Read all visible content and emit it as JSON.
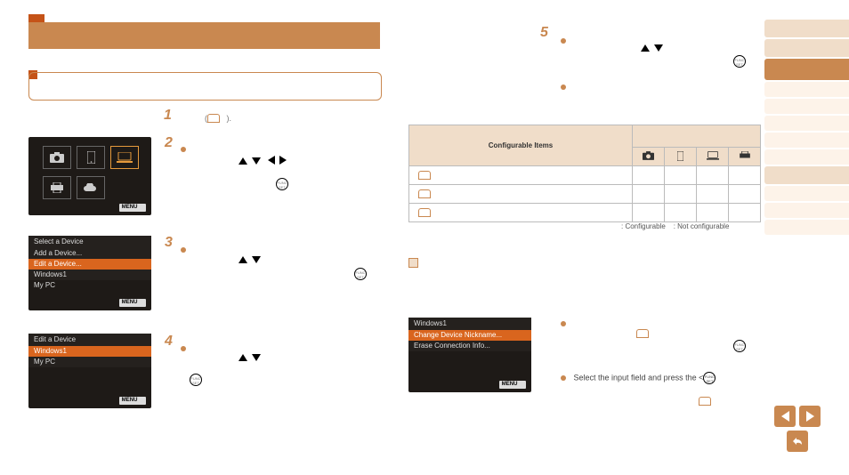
{
  "tabs": {
    "count": 12,
    "active_index": 2
  },
  "header": {
    "title": "",
    "section_title": ""
  },
  "steps": {
    "1": {
      "num": "1",
      "text": "(    )."
    },
    "2": {
      "num": "2",
      "text": ""
    },
    "3": {
      "num": "3",
      "text": ""
    },
    "4": {
      "num": "4",
      "text": ""
    },
    "5": {
      "num": "5",
      "text": ""
    }
  },
  "screens": {
    "A": {
      "menu": "MENU",
      "icons": [
        "camera",
        "phone",
        "laptop",
        "printer",
        "cloud"
      ],
      "selected": "laptop"
    },
    "B": {
      "title": "Select a Device",
      "items": [
        "Add a Device...",
        "Edit a Device...",
        "Windows1",
        "My PC"
      ],
      "selected": 1,
      "menu": "MENU"
    },
    "C": {
      "title": "Edit a Device",
      "items": [
        "Windows1",
        "My PC"
      ],
      "selected": 0,
      "menu": "MENU"
    },
    "D": {
      "title": "Windows1",
      "items": [
        "Change Device Nickname...",
        "Erase Connection Info..."
      ],
      "selected": 0,
      "menu": "MENU"
    }
  },
  "table": {
    "header": "Configurable Items",
    "cols": [
      "camera",
      "phone",
      "laptop",
      "printer"
    ],
    "rows": 3,
    "legend_a": ": Configurable",
    "legend_b": ": Not configurable"
  },
  "body_text": {
    "select_input": "Select the input field and press the <"
  },
  "icons": {
    "funcset": "FUNC SET",
    "menu": "MENU"
  }
}
